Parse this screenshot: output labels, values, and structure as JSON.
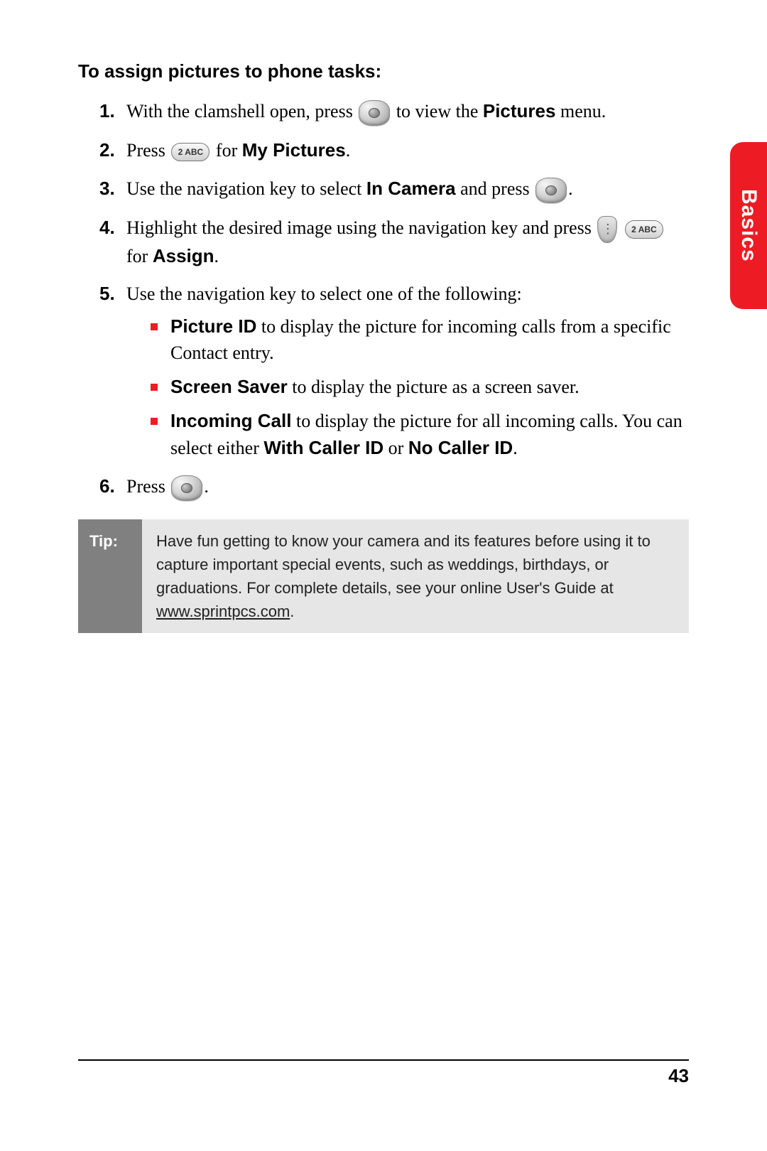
{
  "heading": "To assign pictures to phone tasks:",
  "side_tab": "Basics",
  "page_number": "43",
  "key2_label": "2 ABC",
  "steps": {
    "s1a": "With the clamshell open, press ",
    "s1b": " to view the ",
    "s1_bold": "Pictures",
    "s1c": " menu.",
    "s2a": "Press ",
    "s2b": " for ",
    "s2_bold": "My Pictures",
    "s2c": ".",
    "s3a": "Use the navigation key to select ",
    "s3_bold": "In Camera",
    "s3b": " and press ",
    "s3c": ".",
    "s4a": "Highlight the desired image using the navigation key and press ",
    "s4b": " for ",
    "s4_bold": "Assign",
    "s4c": ".",
    "s5a": "Use the navigation key to select one of the following:",
    "sub1_bold": "Picture ID",
    "sub1_rest": " to display the picture for incoming calls from a specific Contact entry.",
    "sub2_bold": "Screen Saver",
    "sub2_rest": " to display the picture as a screen saver.",
    "sub3_bold1": "Incoming Call",
    "sub3_mid": " to display the picture for all incoming calls. You can select either ",
    "sub3_bold2": "With Caller ID",
    "sub3_or": " or ",
    "sub3_bold3": "No Caller ID",
    "sub3_end": ".",
    "s6a": "Press ",
    "s6b": "."
  },
  "tip": {
    "label": "Tip:",
    "body_a": "Have fun getting to know your camera and its features before using it to capture important special events, such as weddings, birthdays, or graduations. For complete details, see your online User's Guide at ",
    "url": "www.sprintpcs.com",
    "body_b": "."
  }
}
